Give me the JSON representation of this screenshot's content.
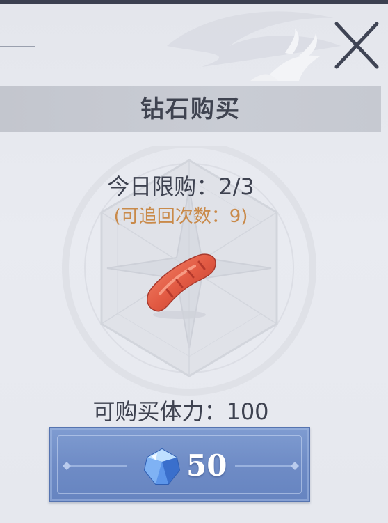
{
  "dialog": {
    "title": "钻石购买",
    "daily_limit": "今日限购：2/3",
    "recoverable": "(可追回次数：9)",
    "stamina": "可购买体力：100",
    "item_icon": "sausage-icon",
    "close_icon": "close-icon"
  },
  "buy_button": {
    "currency_icon": "diamond-icon",
    "price": "50"
  },
  "colors": {
    "panel_bg": "#e6e8ee",
    "title_bar": "#c6c9d1",
    "text": "#3e4250",
    "accent_orange": "#c98a4a",
    "button_blue": "#6f8cc6"
  }
}
